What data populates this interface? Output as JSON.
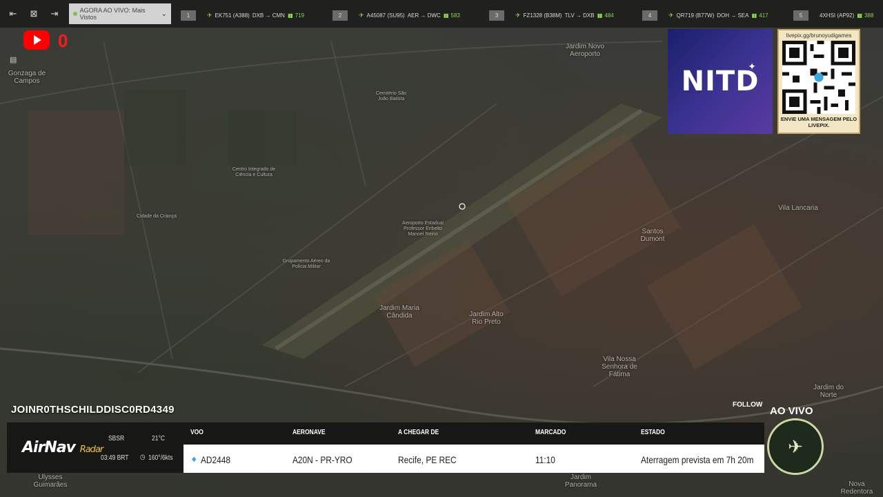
{
  "topbar": {
    "live_label": "AGORA AO VIVO: Mais Vistos",
    "flights": [
      {
        "rank": "1",
        "flight": "EK751 (A388)",
        "route": "DXB → CMN",
        "viewers": "719"
      },
      {
        "rank": "2",
        "flight": "A45087 (SU95)",
        "route": "AER → DWC",
        "viewers": "583"
      },
      {
        "rank": "3",
        "flight": "FZ1328 (B38M)",
        "route": "TLV → DXB",
        "viewers": "484"
      },
      {
        "rank": "4",
        "flight": "QR719 (B77W)",
        "route": "DOH → SEA",
        "viewers": "417"
      },
      {
        "rank": "5",
        "flight": "4XHSI (AP92)",
        "route": "",
        "viewers": "388"
      }
    ]
  },
  "youtube": {
    "count": "0"
  },
  "sponsor": {
    "logo_text": "NITD"
  },
  "qr": {
    "url": "livepix.gg/brunoyudigames",
    "message": "ENVIE UMA MENSAGEM PELO LIVEPIX."
  },
  "map_labels": {
    "gonzaga": "Gonzaga de Campos",
    "jardim_novo": "Jardim Novo Aeroporto",
    "cemiterio": "Cemitério São João Batista",
    "centro_integrado": "Centro Integrado de Ciência e Cultura",
    "cidade_crianca": "Cidade da Criança",
    "aeroporto": "Aeroporto Estadual Professor Eribelto Manoel Reino",
    "grupamento": "Grupamento Aéreo da Polícia Militar",
    "jardim_maria": "Jardim Maria Cândida",
    "jardim_alto": "Jardim Alto Rio Preto",
    "santos_dumont": "Santos Dumont",
    "vila_lancaria": "Vila Lancaria",
    "vila_nossa": "Vila Nossa Senhora de Fátima",
    "jardim_norte": "Jardim do Norte",
    "ulysses": "Ulysses Guimarães",
    "jardim_panorama": "Jardim Panorama",
    "nova_redentora": "Nova Redentora"
  },
  "stream": {
    "channel": "JOINR0THSCHILDDISC0RD4349",
    "follow": "FOLLOW",
    "live": "AO VIVO"
  },
  "airnav": {
    "brand": "AirNav",
    "brand_sub": "Radar",
    "airport": "SBSR",
    "temp": "21°C",
    "time": "03:49 BRT",
    "wind": "160°/6kts"
  },
  "table": {
    "headers": {
      "voo": "VOO",
      "aeronave": "AERONAVE",
      "chegar": "A CHEGAR DE",
      "marcado": "MARCADO",
      "estado": "ESTADO"
    },
    "row": {
      "voo": "AD2448",
      "aeronave": "A20N - PR-YRO",
      "chegar": "Recife, PE REC",
      "marcado": "11:10",
      "estado": "Aterragem prevista em 7h 20m"
    }
  }
}
